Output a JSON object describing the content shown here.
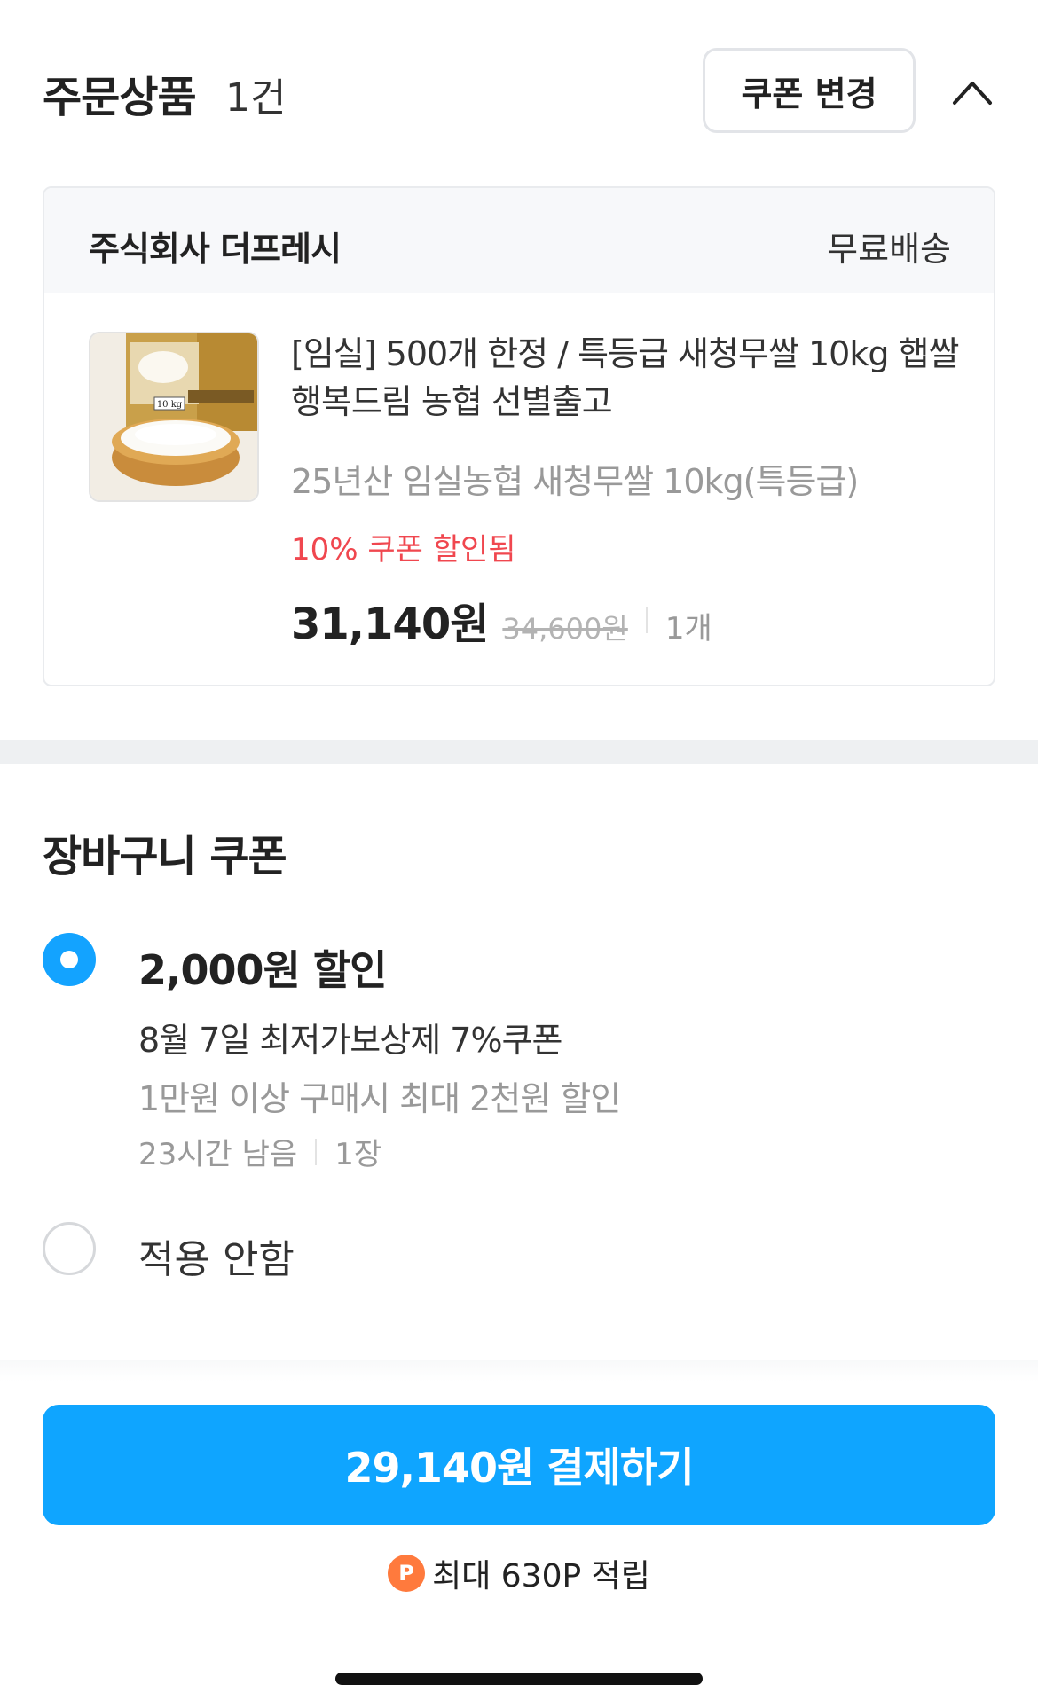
{
  "order": {
    "title": "주문상품",
    "count": "1건",
    "coupon_change_label": "쿠폰 변경",
    "collapse_icon": "chevron-up-icon"
  },
  "seller": {
    "name": "주식회사 더프레시",
    "shipping": "무료배송"
  },
  "product": {
    "name": "[임실] 500개 한정 / 특등급 새청무쌀 10kg 햅쌀 행복드림 농협 선별출고",
    "option": "25년산 임실농협 새청무쌀 10kg(특등급)",
    "discount_note": "10% 쿠폰 할인됨",
    "sale_price": "31,140원",
    "original_price": "34,600원",
    "quantity": "1개",
    "image_label": "10 kg"
  },
  "cart_coupon": {
    "title": "장바구니 쿠폰",
    "options": [
      {
        "selected": true,
        "amount": "2,000원 할인",
        "name": "8월 7일 최저가보상제 7%쿠폰",
        "condition": "1만원 이상 구매시 최대 2천원 할인",
        "time_left": "23시간 남음",
        "count": "1장"
      },
      {
        "selected": false,
        "label": "적용 안함"
      }
    ]
  },
  "checkout": {
    "pay_label": "29,140원 결제하기",
    "points_icon": "P",
    "points_text": "최대 630P 적립"
  },
  "colors": {
    "primary": "#0fa5ff",
    "discount": "#f0474f",
    "points": "#ff7a3d"
  }
}
